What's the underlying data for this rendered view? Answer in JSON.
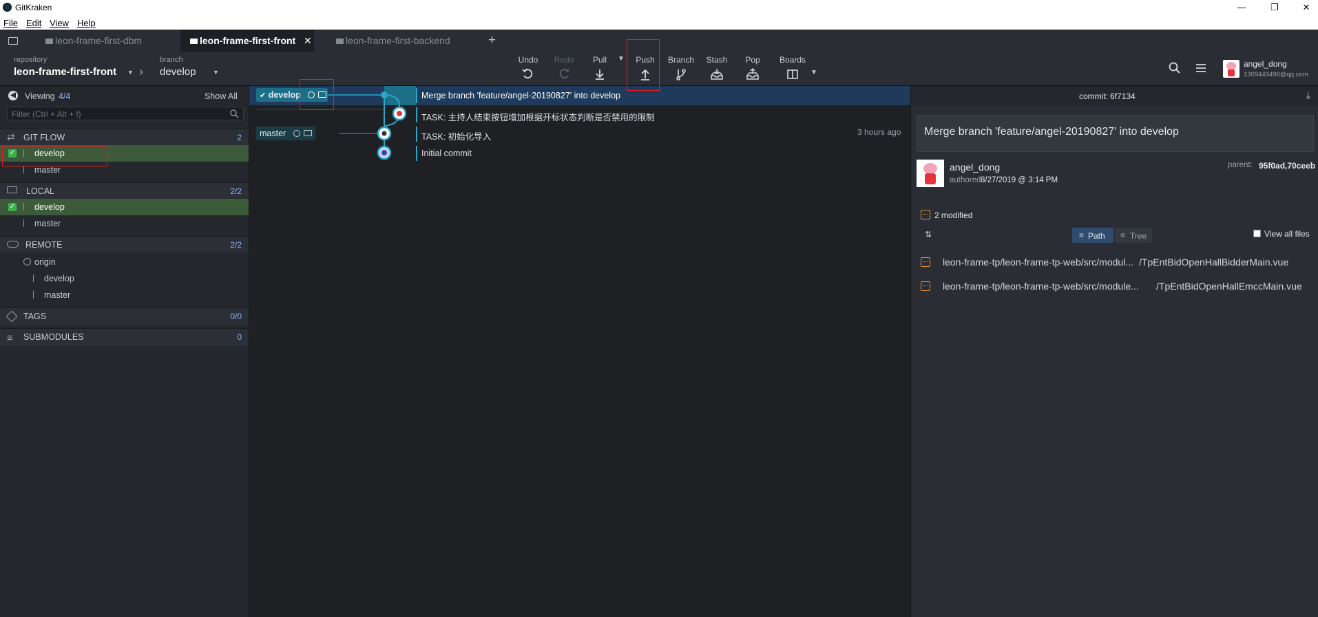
{
  "window": {
    "title": "GitKraken"
  },
  "menu": [
    "File",
    "Edit",
    "View",
    "Help"
  ],
  "tabs": [
    {
      "label": "leon-frame-first-dbm"
    },
    {
      "label": "leon-frame-first-front"
    },
    {
      "label": "leon-frame-first-backend"
    }
  ],
  "toolbar": {
    "repo_label": "repository",
    "repo_name": "leon-frame-first-front",
    "branch_label": "branch",
    "branch_name": "develop",
    "undo": "Undo",
    "redo": "Redo",
    "pull": "Pull",
    "push": "Push",
    "branch": "Branch",
    "stash": "Stash",
    "pop": "Pop",
    "boards": "Boards",
    "user_name": "angel_dong",
    "user_email": "1309449496@qq.com"
  },
  "left": {
    "viewing_label": "Viewing",
    "viewing_count": "4/4",
    "show_all": "Show All",
    "filter_placeholder": "Filter (Ctrl + Alt + f)",
    "gitflow": {
      "name": "GIT FLOW",
      "count": "2",
      "items": [
        "develop",
        "master"
      ]
    },
    "local": {
      "name": "LOCAL",
      "count": "2/2",
      "items": [
        "develop",
        "master"
      ]
    },
    "remote": {
      "name": "REMOTE",
      "count": "2/2",
      "origin": "origin",
      "items": [
        "develop",
        "master"
      ]
    },
    "tags": {
      "name": "TAGS",
      "count": "0/0"
    },
    "submodules": {
      "name": "SUBMODULES",
      "count": "0"
    }
  },
  "graph": {
    "labels": {
      "develop": "develop",
      "master": "master"
    },
    "commits": [
      {
        "msg": "Merge branch 'feature/angel-20190827' into develop",
        "time": ""
      },
      {
        "msg": "TASK: 主持人结束按钮增加根据开标状态判断是否禁用的限制",
        "time": ""
      },
      {
        "msg": "TASK: 初始化导入",
        "time": "3 hours ago"
      },
      {
        "msg": "Initial commit",
        "time": ""
      }
    ]
  },
  "right": {
    "commit_label": "commit:",
    "commit_sha": "6f7134",
    "message": "Merge branch 'feature/angel-20190827' into develop",
    "author": "angel_dong",
    "authored_label": "authored",
    "authored_date": "8/27/2019 @ 3:14 PM",
    "parent_label": "parent:",
    "parent_value": "95f0ad,70ceeb",
    "modified": "2 modified",
    "path_label": "Path",
    "tree_label": "Tree",
    "view_all": "View all files",
    "files": [
      {
        "left": "leon-frame-tp/leon-frame-tp-web/src/modul...",
        "right": "/TpEntBidOpenHallBidderMain.vue"
      },
      {
        "left": "leon-frame-tp/leon-frame-tp-web/src/module...",
        "right": "/TpEntBidOpenHallEmccMain.vue"
      }
    ]
  },
  "colors": {
    "accent": "#2aa6c9",
    "selected": "#3d5b3a",
    "check": "#3cb34a",
    "modified": "#e8912d",
    "highlight": "#e02020"
  }
}
